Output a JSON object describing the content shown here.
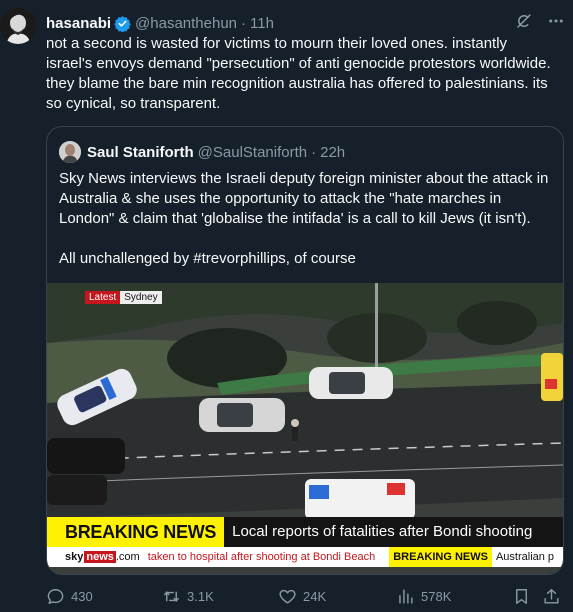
{
  "tweet": {
    "display_name": "hasanabi",
    "handle": "@hasanthehun",
    "separator": "·",
    "time": "11h",
    "text": "not a second is wasted for victims to mourn their loved ones. instantly israel's envoys demand \"persecution\" of anti genocide protestors worldwide. they blame the bare min recognition australia has offered to palestinians. its so cynical, so transparent.",
    "icons": {
      "verified": "verified-badge-icon",
      "grok": "grok-icon",
      "more": "more-options-icon"
    },
    "accent_color": "#1d9bf0"
  },
  "quote": {
    "display_name": "Saul Staniforth",
    "handle": "@SaulStaniforth",
    "separator": "·",
    "time": "22h",
    "text_1": "Sky News interviews the Israeli deputy foreign minister about the attack in Australia & she uses the opportunity to attack the \"hate marches in London\" & claim that 'globalise the intifada' is a call to kill Jews (it isn't).",
    "text_2": "All unchallenged by #trevorphillips, of course",
    "media": {
      "latest_tag": "Latest",
      "location_tag": "Sydney",
      "breaking_label": "BREAKING NEWS",
      "headline": "Local reports of fatalities after Bondi shooting",
      "logo_sky": "sky",
      "logo_news": "news",
      "logo_com": ".com",
      "ticker_text": "taken to hospital after shooting at Bondi Beach",
      "ticker_breaking": "BREAKING NEWS",
      "ticker_tail": "Australian p"
    }
  },
  "actions": {
    "replies": "430",
    "reposts": "3.1K",
    "likes": "24K",
    "views": "578K",
    "icons": {
      "reply": "reply-icon",
      "repost": "repost-icon",
      "like": "heart-icon",
      "views": "views-icon",
      "bookmark": "bookmark-icon",
      "share": "share-icon"
    }
  }
}
